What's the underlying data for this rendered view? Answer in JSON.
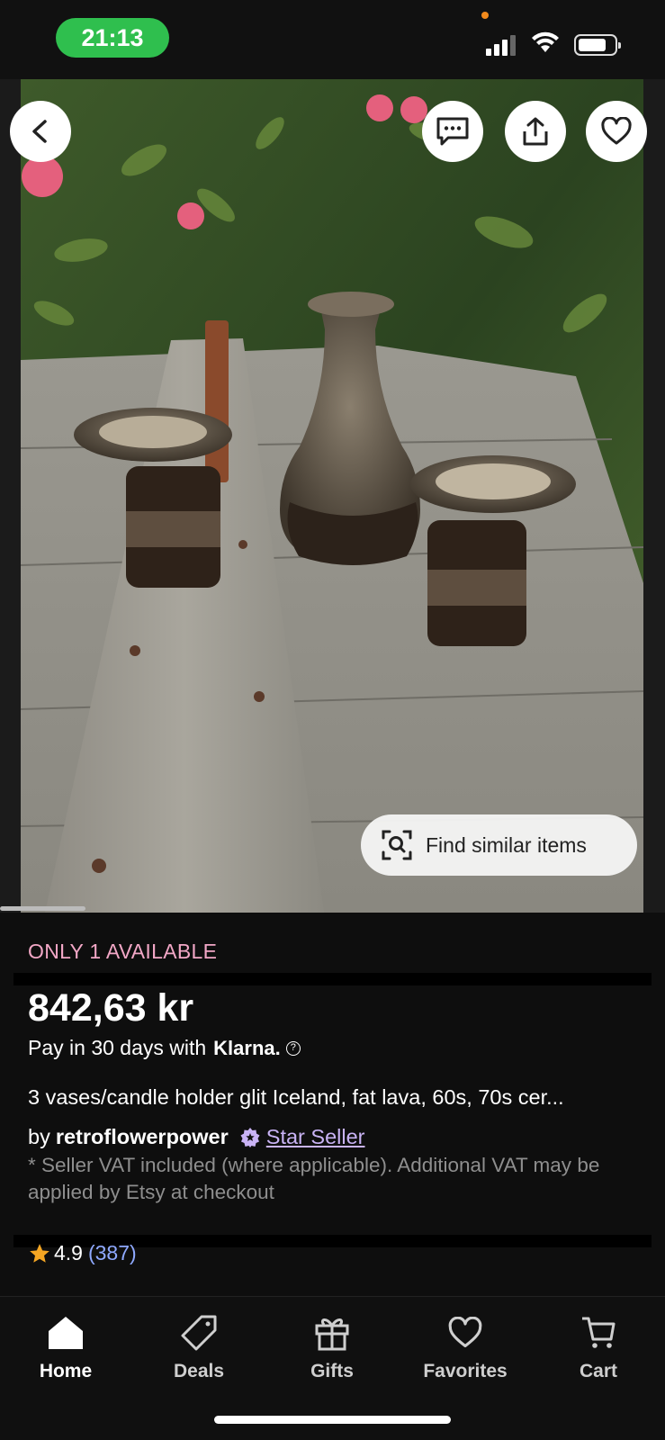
{
  "status_bar": {
    "time": "21:13"
  },
  "listing": {
    "availability": "ONLY 1 AVAILABLE",
    "price": "842,63 kr",
    "klarna_text": "Pay in 30 days with",
    "klarna_brand": "Klarna.",
    "title": "3 vases/candle holder glit Iceland, fat lava, 60s, 70s cer...",
    "seller_prefix": "by",
    "seller_name": "retroflowerpower",
    "star_seller_label": "Star Seller",
    "vat_note": "* Seller VAT included (where applicable). Additional VAT may be applied by Etsy at checkout",
    "rating": "4.9",
    "review_count": "(387)"
  },
  "image_actions": {
    "find_similar_label": "Find similar items"
  },
  "tab_bar": {
    "items": [
      {
        "label": "Home",
        "icon": "home-icon",
        "active": true
      },
      {
        "label": "Deals",
        "icon": "tag-icon"
      },
      {
        "label": "Gifts",
        "icon": "gift-icon"
      },
      {
        "label": "Favorites",
        "icon": "heart-icon"
      },
      {
        "label": "Cart",
        "icon": "cart-icon"
      }
    ]
  },
  "colors": {
    "accent_pink": "#f2a7c6",
    "star_seller": "#c9b3f5",
    "link_blue": "#8fa9ff",
    "star": "#f5a623",
    "time_pill": "#2fbf4e"
  }
}
